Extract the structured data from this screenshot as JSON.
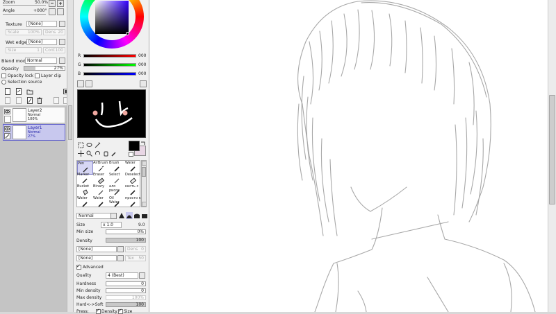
{
  "nav": {
    "zoom_label": "Zoom",
    "zoom_value": "50.0%",
    "angle_label": "Angle",
    "angle_value": "+000°"
  },
  "color": {
    "r_label": "R",
    "r_value": "000",
    "g_label": "G",
    "g_value": "000",
    "b_label": "B",
    "b_value": "000",
    "primary": "#000000",
    "secondary": "#e8d6e4"
  },
  "texture": {
    "label": "Texture",
    "value": "[None]",
    "scale_label": "Scale",
    "scale_value": "100%",
    "density_label": "Dens",
    "density_value": "20"
  },
  "wet_edge": {
    "label": "Wet edge",
    "value": "[None]",
    "size_label": "Size",
    "size_value": "1",
    "contrast_label": "Cont",
    "contrast_value": "100"
  },
  "layer_props": {
    "blend_label": "Blend mode",
    "blend_value": "Normal",
    "opacity_label": "Opacity",
    "opacity_value": "27%",
    "opacity_fraction": 0.27,
    "opacity_lock_label": "Opacity lock",
    "layer_clip_label": "Layer clip",
    "selection_source_label": "Selection source"
  },
  "layers": [
    {
      "name": "Layer2",
      "mode": "Normal",
      "opacity": "100%"
    },
    {
      "name": "Layer1",
      "mode": "Normal",
      "opacity": "27%"
    }
  ],
  "brushes": [
    {
      "label": "Pen"
    },
    {
      "label": "AirBrush"
    },
    {
      "label": "Brush"
    },
    {
      "label": "Water"
    },
    {
      "label": "Marker"
    },
    {
      "label": "Eraser"
    },
    {
      "label": "Select"
    },
    {
      "label": "Deselect"
    },
    {
      "label": "Bucket"
    },
    {
      "label": "Binary"
    },
    {
      "label": "ало рисов"
    },
    {
      "label": "кисть с"
    },
    {
      "label": "Water"
    },
    {
      "label": "Water"
    },
    {
      "label": "Oil Water"
    },
    {
      "label": "просто к"
    }
  ],
  "brush_settings": {
    "blend_value": "Normal",
    "size_label": "Size",
    "size_mult": "x 1.0",
    "size_value": "9.0",
    "min_size_label": "Min size",
    "min_size_value": "0%",
    "density_label": "Density",
    "density_value": "100",
    "shape_value": "[None]",
    "shape_dens_label": "Dens",
    "shape_dens_value": "0",
    "texture_value": "[None]",
    "texture_label": "Tex",
    "texture_pct": "50",
    "advanced_label": "Advanced",
    "quality_label": "Quality",
    "quality_value": "4 (Best)",
    "hardness_label": "Hardness",
    "hardness_value": "0",
    "min_density_label": "Min density",
    "min_density_value": "0",
    "max_density_label": "Max density",
    "max_density_value": "100%",
    "hard_soft_label": "Hard<->Soft",
    "hard_soft_value": "100",
    "pressure_label": "Press:",
    "pressure_density_label": "Density",
    "pressure_size_label": "Size"
  }
}
